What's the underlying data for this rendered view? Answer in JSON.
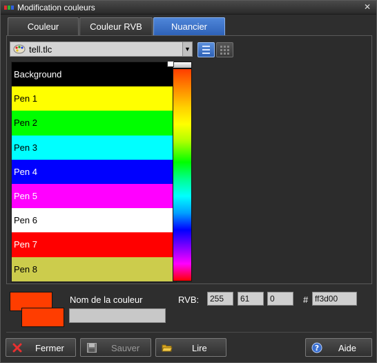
{
  "window": {
    "title": "Modification couleurs",
    "close_symbol": "✕"
  },
  "tabs": [
    {
      "label": "Couleur",
      "active": false
    },
    {
      "label": "Couleur RVB",
      "active": false
    },
    {
      "label": "Nuancier",
      "active": true
    }
  ],
  "palette_select": {
    "selected": "tell.tlc"
  },
  "colors": [
    {
      "name": "Background",
      "color": "#000000",
      "text_color": "#ffffff"
    },
    {
      "name": "Pen 1",
      "color": "#ffff00",
      "text_color": "#000000"
    },
    {
      "name": "Pen 2",
      "color": "#00ff00",
      "text_color": "#000000"
    },
    {
      "name": "Pen 3",
      "color": "#00ffff",
      "text_color": "#000000"
    },
    {
      "name": "Pen 4",
      "color": "#0000ff",
      "text_color": "#ffffff"
    },
    {
      "name": "Pen 5",
      "color": "#ff00ff",
      "text_color": "#ffffff"
    },
    {
      "name": "Pen 6",
      "color": "#ffffff",
      "text_color": "#000000"
    },
    {
      "name": "Pen 7",
      "color": "#ff0000",
      "text_color": "#ffffff"
    },
    {
      "name": "Pen 8",
      "color": "#cccc4c",
      "text_color": "#000000"
    }
  ],
  "current_color": {
    "name_label": "Nom de la couleur",
    "name_value": "",
    "rvb_label": "RVB:",
    "r": "255",
    "g": "61",
    "b": "0",
    "hash_label": "#",
    "hex": "ff3d00",
    "swatch": "#ff3d00"
  },
  "buttons": {
    "close": "Fermer",
    "save": "Sauver",
    "load": "Lire",
    "help": "Aide"
  }
}
